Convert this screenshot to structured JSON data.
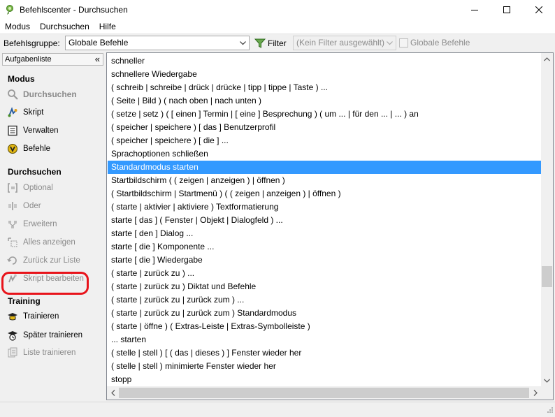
{
  "window": {
    "title": "Befehlscenter - Durchsuchen"
  },
  "menu": [
    "Modus",
    "Durchsuchen",
    "Hilfe"
  ],
  "toolbar": {
    "group_label": "Befehlsgruppe:",
    "group_value": "Globale Befehle",
    "filter_label": "Filter",
    "filter_value": "(Kein Filter ausgewählt)",
    "global_label": "Globale Befehle"
  },
  "sidebar": {
    "header": "Aufgabenliste",
    "sections": {
      "modus": {
        "title": "Modus",
        "items": [
          "Durchsuchen",
          "Skript",
          "Verwalten",
          "Befehle"
        ]
      },
      "durchsuchen": {
        "title": "Durchsuchen",
        "items": [
          "Optional",
          "Oder",
          "Erweitern",
          "Alles anzeigen",
          "Zurück zur Liste",
          "Skript bearbeiten"
        ]
      },
      "training": {
        "title": "Training",
        "items": [
          "Trainieren",
          "Später trainieren",
          "Liste trainieren"
        ]
      }
    }
  },
  "commands": [
    "schneller",
    "schnellere Wiedergabe",
    "( schreib | schreibe | drück | drücke | tipp | tippe | Taste ) ...",
    "( Seite | Bild ) ( nach oben | nach unten )",
    "( setze | setz ) ( [ einen ] Termin | [ eine ] Besprechung ) ( um ... | für den ... | ... ) an",
    "( speicher | speichere ) [ das ] Benutzerprofil",
    "( speicher | speichere ) [ die ] ...",
    "Sprachoptionen schließen",
    "Standardmodus starten",
    "Startbildschirm ( ( zeigen | anzeigen ) | öffnen )",
    "( Startbildschirm | Startmenü ) ( ( zeigen | anzeigen ) | öffnen )",
    "( starte | aktivier | aktiviere ) Textformatierung",
    "starte [ das ] ( Fenster | Objekt | Dialogfeld ) ...",
    "starte [ den ] Dialog ...",
    "starte [ die ] Komponente ...",
    "starte [ die ] Wiedergabe",
    "( starte | zurück zu ) ...",
    "( starte | zurück zu ) Diktat und Befehle",
    "( starte | zurück zu | zurück zum ) ...",
    "( starte | zurück zu | zurück zum ) Standardmodus",
    "( starte | öffne ) ( Extras-Leiste | Extras-Symbolleiste )",
    "... starten",
    "( stelle | stell ) [ ( das | dieses ) ] Fenster wieder her",
    "( stelle | stell ) minimierte Fenster wieder her",
    "stopp"
  ],
  "selected_command": "Standardmodus starten",
  "colors": {
    "selection": "#3399ff",
    "highlight_ring": "#e8141b"
  }
}
